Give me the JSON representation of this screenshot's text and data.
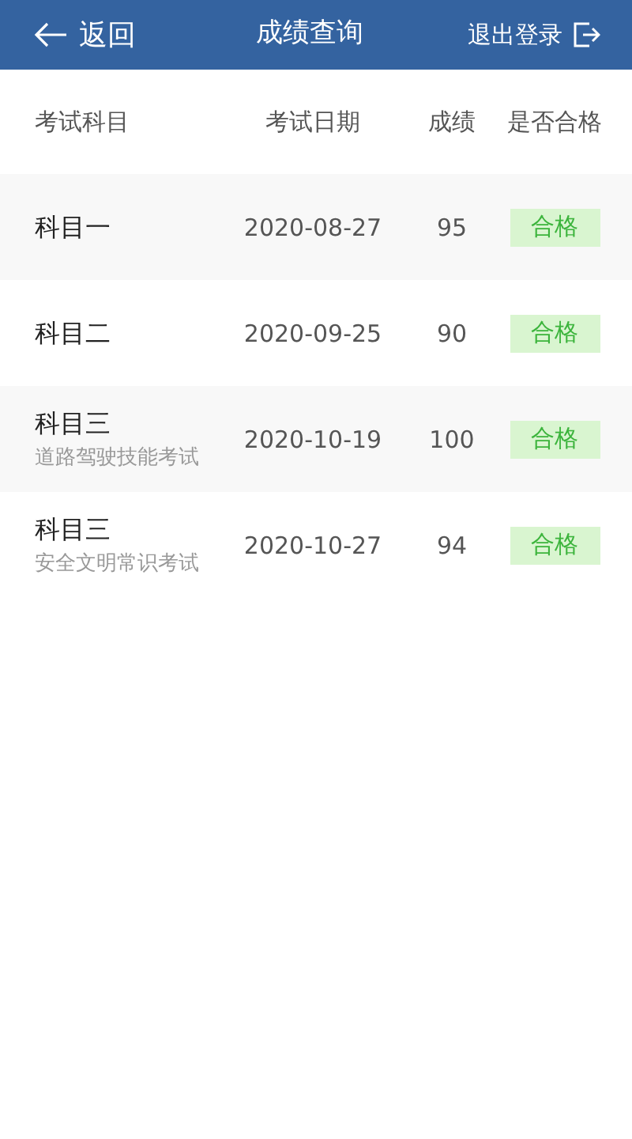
{
  "header": {
    "back": "返回",
    "title": "成绩查询",
    "logout": "退出登录"
  },
  "table": {
    "columns": [
      "考试科目",
      "考试日期",
      "成绩",
      "是否合格"
    ],
    "rows": [
      {
        "subject": "科目一",
        "date": "2020-08-27",
        "score": "95",
        "result": "合格",
        "passed": true
      },
      {
        "subject": "科目二",
        "date": "2020-09-25",
        "score": "90",
        "result": "合格",
        "passed": true
      },
      {
        "subject": "科目三",
        "note": "道路驾驶技能考试",
        "date": "2020-10-19",
        "score": "100",
        "result": "合格",
        "passed": true
      },
      {
        "subject": "科目三",
        "note": "安全文明常识考试",
        "date": "2020-10-27",
        "score": "94",
        "result": "合格",
        "passed": true
      }
    ]
  }
}
